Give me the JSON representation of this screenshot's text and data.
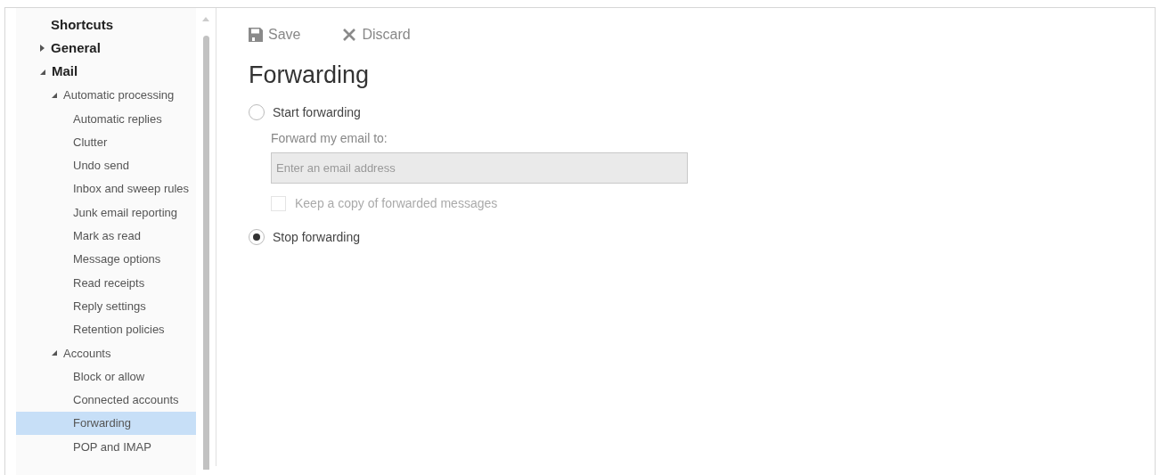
{
  "sidebar": {
    "items": [
      {
        "label": "Shortcuts",
        "selected": false
      },
      {
        "label": "General",
        "selected": false,
        "expanded": false
      },
      {
        "label": "Mail",
        "selected": false,
        "expanded": true,
        "children": [
          {
            "label": "Automatic processing",
            "selected": false,
            "expanded": true,
            "children": [
              {
                "label": "Automatic replies",
                "selected": false
              },
              {
                "label": "Clutter",
                "selected": false
              },
              {
                "label": "Undo send",
                "selected": false
              },
              {
                "label": "Inbox and sweep rules",
                "selected": false
              },
              {
                "label": "Junk email reporting",
                "selected": false
              },
              {
                "label": "Mark as read",
                "selected": false
              },
              {
                "label": "Message options",
                "selected": false
              },
              {
                "label": "Read receipts",
                "selected": false
              },
              {
                "label": "Reply settings",
                "selected": false
              },
              {
                "label": "Retention policies",
                "selected": false
              }
            ]
          },
          {
            "label": "Accounts",
            "selected": false,
            "expanded": true,
            "children": [
              {
                "label": "Block or allow",
                "selected": false
              },
              {
                "label": "Connected accounts",
                "selected": false
              },
              {
                "label": "Forwarding",
                "selected": true
              },
              {
                "label": "POP and IMAP",
                "selected": false
              }
            ]
          }
        ]
      }
    ]
  },
  "toolbar": {
    "save": "Save",
    "discard": "Discard"
  },
  "title": "Forwarding",
  "options": [
    {
      "kind": "radio",
      "label": "Start forwarding",
      "selected": false
    },
    {
      "kind": "label",
      "label": "Forward my email to:"
    },
    {
      "kind": "input",
      "placeholder": "Enter an email address",
      "disabled": true
    },
    {
      "kind": "checkbox",
      "label": "Keep a copy of forwarded messages",
      "checked": false,
      "disabled": true
    },
    {
      "kind": "radio",
      "label": "Stop forwarding",
      "selected": true
    }
  ]
}
